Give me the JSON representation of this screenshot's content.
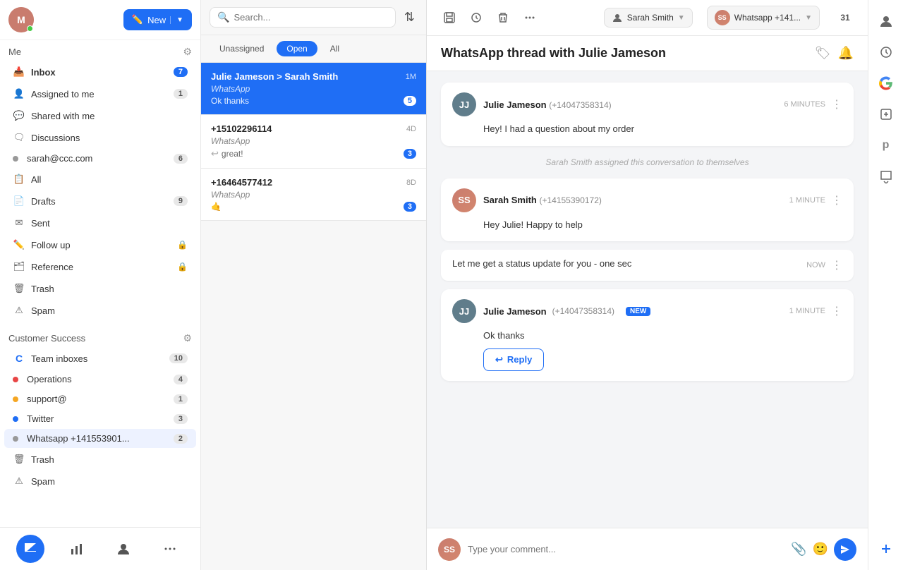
{
  "sidebar": {
    "user_initials": "M",
    "compose_label": "New",
    "me_label": "Me",
    "inbox_label": "Inbox",
    "inbox_count": 7,
    "assigned_label": "Assigned to me",
    "assigned_count": 1,
    "shared_label": "Shared with me",
    "discussions_label": "Discussions",
    "sarah_email": "sarah@ccc.com",
    "sarah_count": 6,
    "all_label": "All",
    "drafts_label": "Drafts",
    "drafts_count": 9,
    "sent_label": "Sent",
    "followup_label": "Follow up",
    "reference_label": "Reference",
    "trash_label": "Trash",
    "spam_label": "Spam",
    "customer_success_label": "Customer Success",
    "team_inboxes_label": "Team inboxes",
    "team_inboxes_count": 10,
    "operations_label": "Operations",
    "operations_count": 4,
    "support_label": "support@",
    "support_count": 1,
    "twitter_label": "Twitter",
    "twitter_count": 3,
    "whatsapp_label": "Whatsapp +141553901...",
    "whatsapp_count": 2,
    "trash2_label": "Trash",
    "spam2_label": "Spam"
  },
  "conv_list": {
    "search_placeholder": "Search...",
    "tab_unassigned": "Unassigned",
    "tab_open": "Open",
    "tab_all": "All",
    "conversations": [
      {
        "name": "Julie Jameson > Sarah Smith",
        "time": "1M",
        "channel": "WhatsApp",
        "preview": "Ok thanks",
        "badge": 5,
        "active": true
      },
      {
        "name": "+15102296114",
        "time": "4D",
        "channel": "WhatsApp",
        "preview": "great!",
        "badge": 3,
        "active": false,
        "has_reply_icon": true
      },
      {
        "name": "+16464577412",
        "time": "8D",
        "channel": "WhatsApp",
        "preview": "🤙",
        "badge": 3,
        "active": false
      }
    ]
  },
  "main": {
    "thread_title": "WhatsApp thread with Julie Jameson",
    "toolbar": {
      "save_icon": "🗂",
      "clock_icon": "🕐",
      "trash_icon": "🗑",
      "more_icon": "···",
      "agent_name": "Sarah Smith",
      "inbox_name": "Whatsapp +141...",
      "calendar_icon": "31"
    },
    "messages": [
      {
        "sender": "Julie Jameson",
        "phone": "(+14047358314)",
        "time": "6 MINUTES",
        "avatar_initials": "JJ",
        "avatar_type": "julie",
        "body": "Hey! I had a question about my order",
        "is_new": false
      },
      {
        "system": "Sarah Smith assigned this conversation to themselves"
      },
      {
        "sender": "Sarah Smith",
        "phone": "(+14155390172)",
        "time": "1 MINUTE",
        "avatar_initials": "SS",
        "avatar_type": "sarah",
        "body": "Hey Julie! Happy to help",
        "is_new": false
      },
      {
        "inline": true,
        "body": "Let me get a status update for you - one sec",
        "time": "NOW"
      },
      {
        "sender": "Julie Jameson",
        "phone": "(+14047358314)",
        "time": "1 MINUTE",
        "avatar_initials": "JJ",
        "avatar_type": "julie",
        "body": "Ok thanks",
        "is_new": true
      }
    ],
    "reply_button": "Reply",
    "composer_placeholder": "Type your comment..."
  }
}
